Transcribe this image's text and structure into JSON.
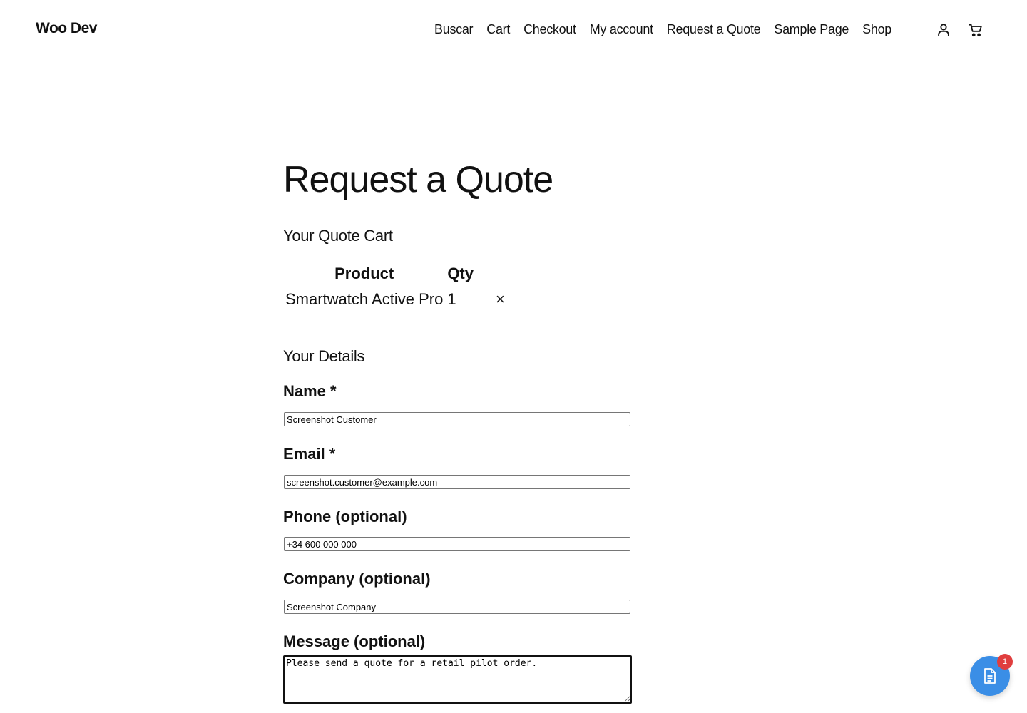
{
  "site": {
    "title": "Woo Dev"
  },
  "nav": {
    "items": [
      "Buscar",
      "Cart",
      "Checkout",
      "My account",
      "Request a Quote",
      "Sample Page",
      "Shop"
    ],
    "account_icon": "user-icon",
    "cart_icon": "shopping-cart-icon"
  },
  "page": {
    "title": "Request a Quote"
  },
  "quote_cart": {
    "heading": "Your Quote Cart",
    "columns": [
      "Product",
      "Qty"
    ],
    "rows": [
      {
        "product": "Smartwatch Active Pro",
        "qty": "1",
        "remove": "×"
      }
    ]
  },
  "details": {
    "heading": "Your Details",
    "name": {
      "label": "Name *",
      "value": "Screenshot Customer"
    },
    "email": {
      "label": "Email *",
      "value": "screenshot.customer@example.com"
    },
    "phone": {
      "label": "Phone (optional)",
      "value": "+34 600 000 000"
    },
    "company": {
      "label": "Company (optional)",
      "value": "Screenshot Company"
    },
    "message": {
      "label": "Message (optional)",
      "value": "Please send a quote for a retail pilot order."
    }
  },
  "quote_button": {
    "icon": "document-icon",
    "badge": "1"
  },
  "colors": {
    "accent": "#3a8ee6",
    "badge": "#e03e3e",
    "remove": "#d63638",
    "text": "#111111"
  }
}
